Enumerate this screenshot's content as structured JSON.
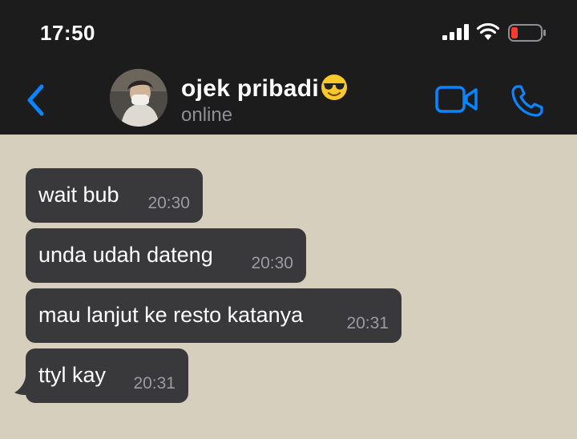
{
  "status_bar": {
    "time": "17:50",
    "icons": [
      "cellular-signal-icon",
      "wifi-icon",
      "battery-low-icon"
    ]
  },
  "header": {
    "contact_name": "ojek pribadi",
    "contact_emoji": "smiling-face-with-sunglasses",
    "contact_status": "online",
    "icons": [
      "back-chevron-icon",
      "video-call-icon",
      "phone-icon"
    ]
  },
  "messages": [
    {
      "text": "wait bub",
      "time": "20:30",
      "direction": "incoming"
    },
    {
      "text": "unda udah dateng",
      "time": "20:30",
      "direction": "incoming"
    },
    {
      "text": "mau lanjut ke resto katanya",
      "time": "20:31",
      "direction": "incoming"
    },
    {
      "text": "ttyl kay",
      "time": "20:31",
      "direction": "incoming"
    }
  ],
  "colors": {
    "accent": "#0a84ff",
    "header_bg": "#1c1c1d",
    "chat_bg": "#d7cfbd",
    "bubble_bg": "#39393b",
    "battery_low": "#ff3b30"
  }
}
